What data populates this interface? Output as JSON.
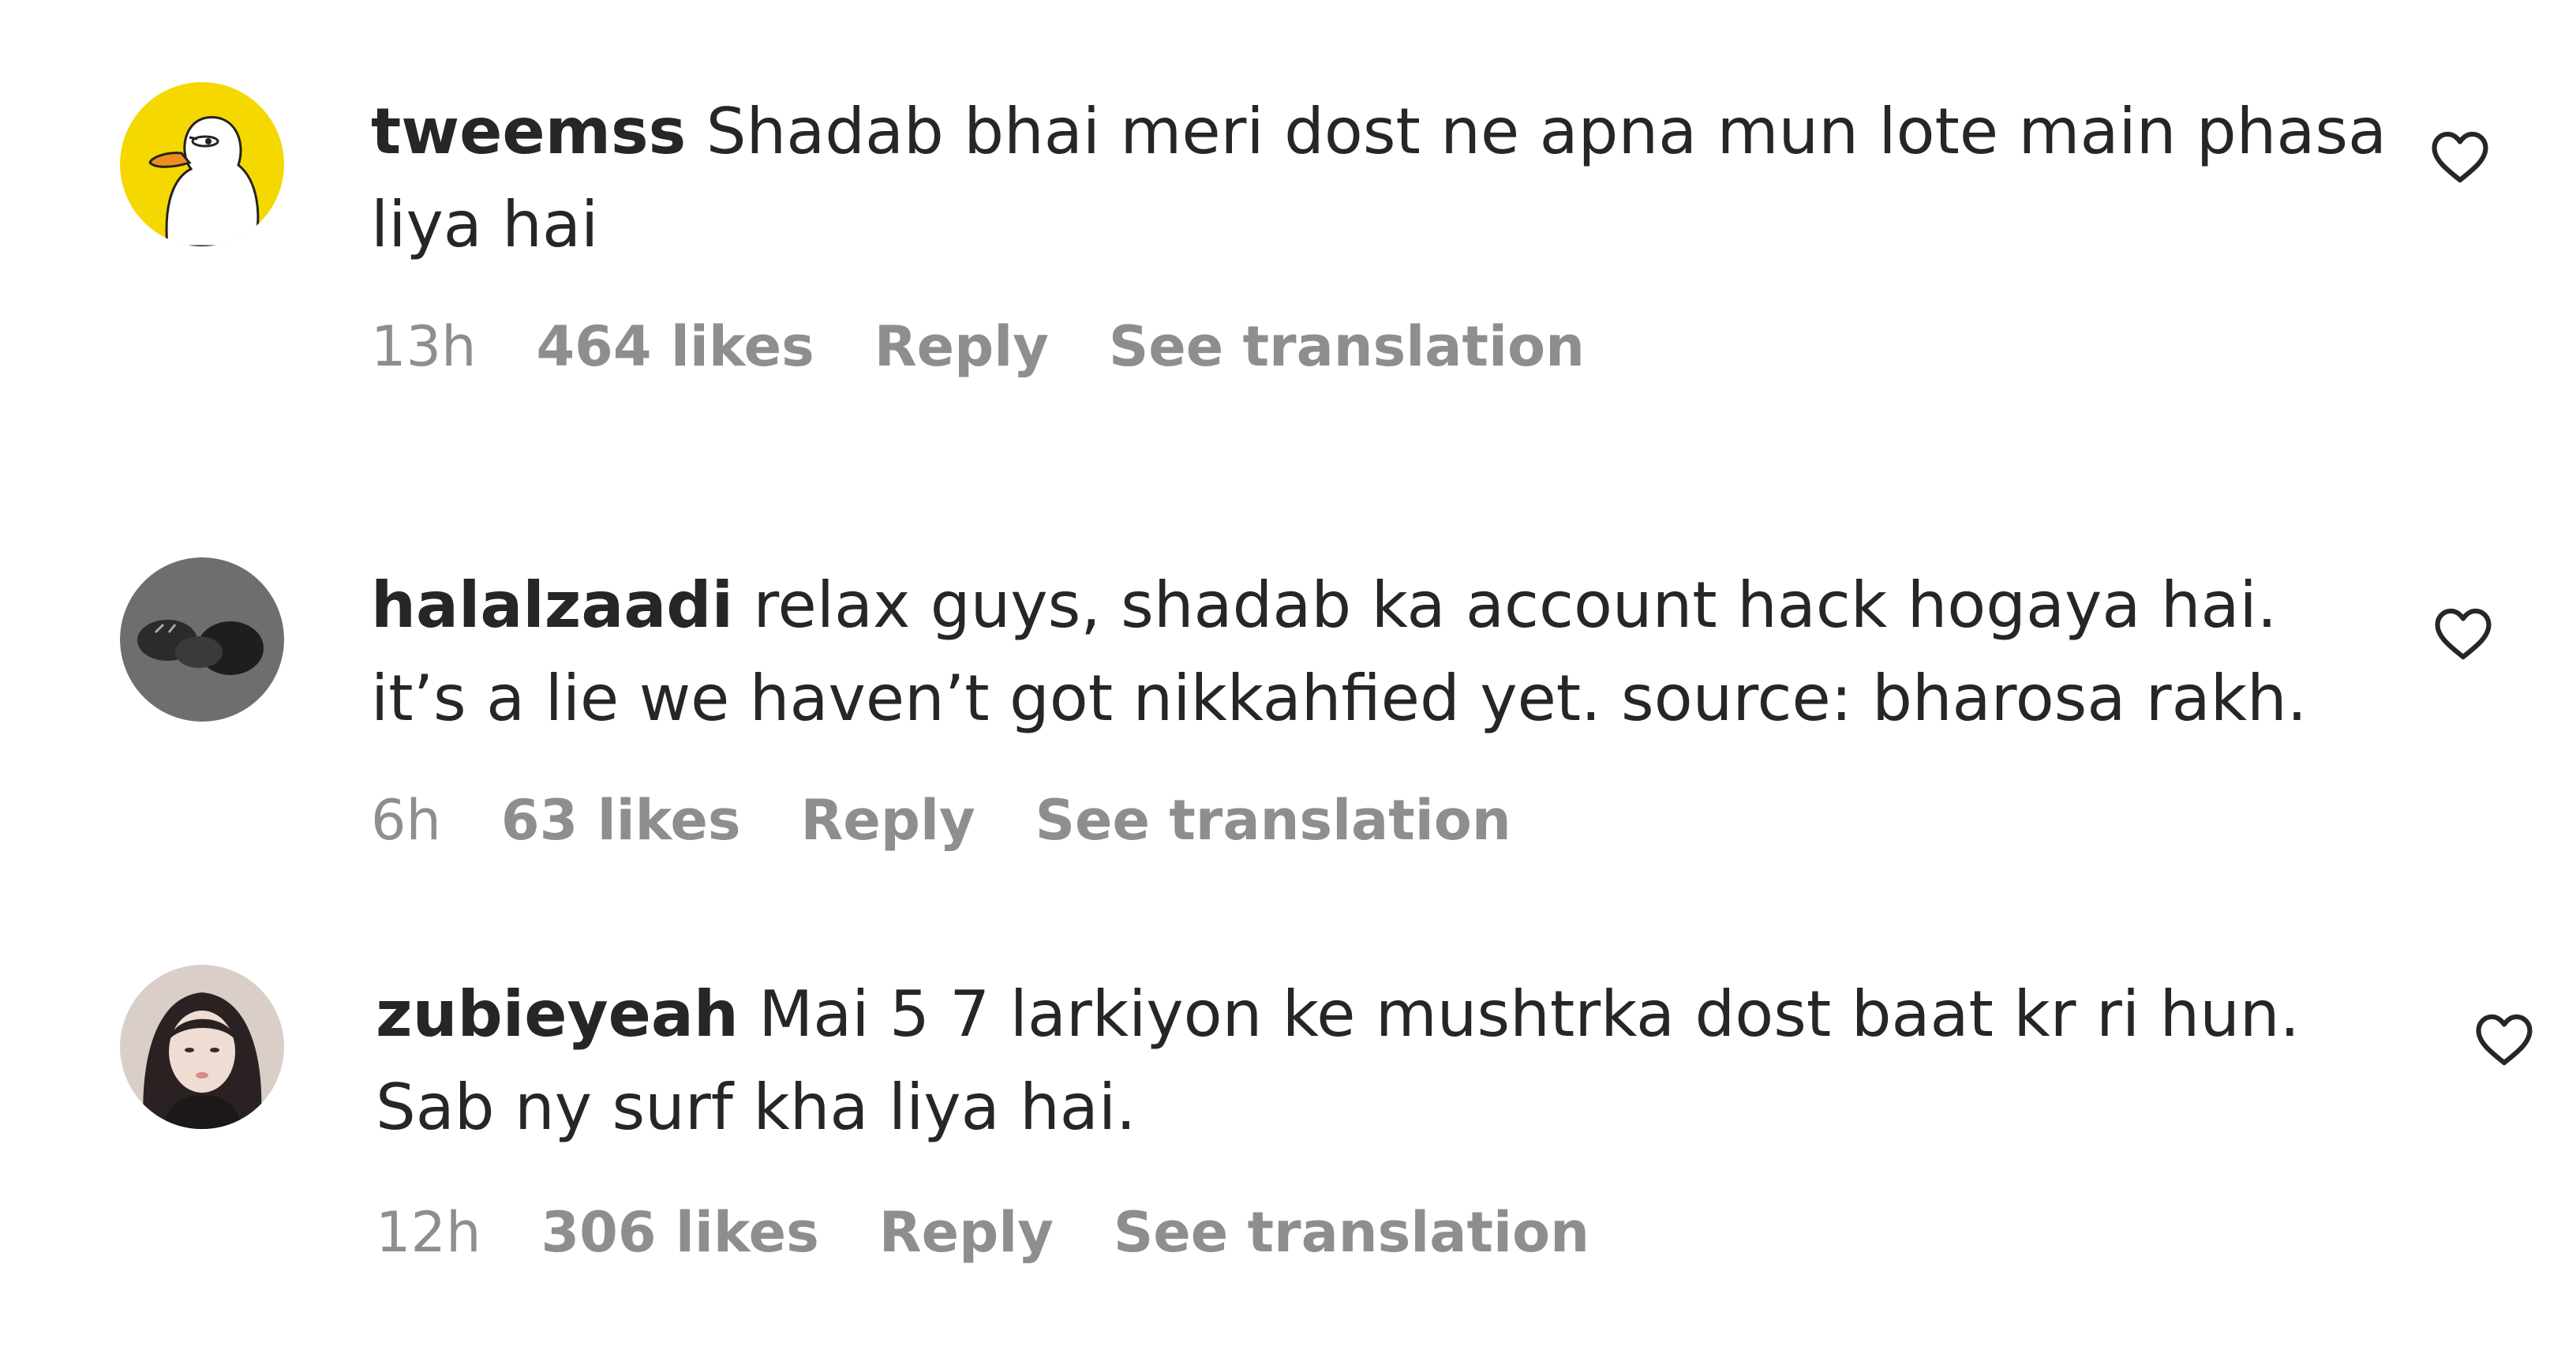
{
  "comments": [
    {
      "username": "tweemss",
      "text": "Shadab bhai meri dost ne apna mun lote main phasa liya hai",
      "time": "13h",
      "likes": "464 likes",
      "reply": "Reply",
      "translate": "See translation",
      "avatar_icon": "duck-avatar"
    },
    {
      "username": "halalzaadi",
      "text": "relax guys, shadab ka account hack hogaya hai. it’s a lie we haven’t got nikkahfied yet. source: bharosa rakh.",
      "time": "6h",
      "likes": "63 likes",
      "reply": "Reply",
      "translate": "See translation",
      "avatar_icon": "dark-photo-avatar"
    },
    {
      "username": "zubieyeah",
      "text": "Mai 5 7 larkiyon ke mushtrka dost baat kr ri hun. Sab ny surf kha liya hai.",
      "time": "12h",
      "likes": "306 likes",
      "reply": "Reply",
      "translate": "See translation",
      "avatar_icon": "portrait-avatar"
    }
  ],
  "colors": {
    "text": "#262626",
    "meta": "#8e8e8e",
    "duck_bg": "#f5d800"
  },
  "icons": {
    "like": "heart-icon"
  }
}
